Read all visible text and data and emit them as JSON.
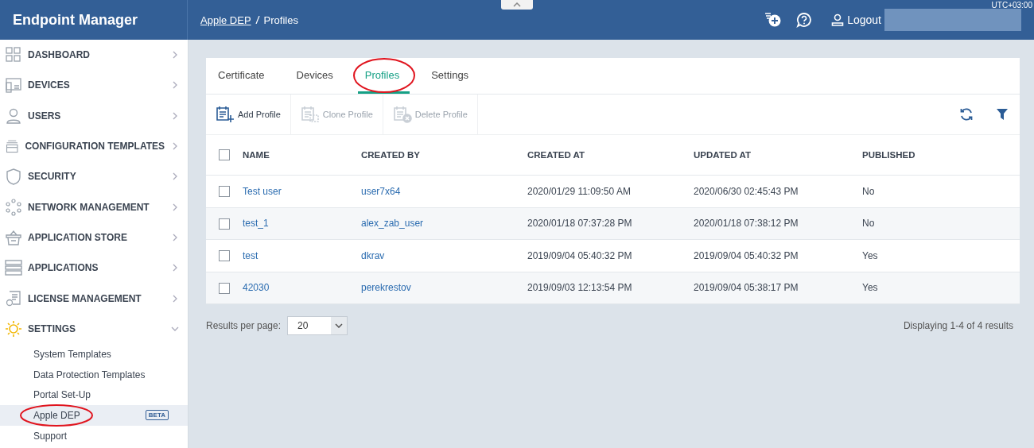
{
  "app": {
    "title": "Endpoint Manager"
  },
  "breadcrumb": [
    {
      "label": "Apple DEP",
      "link": true
    },
    {
      "label": "Profiles",
      "link": false
    }
  ],
  "header": {
    "logout": "Logout",
    "timezone": "UTC+03:00"
  },
  "sidebar": {
    "items": [
      {
        "label": "DASHBOARD",
        "expanded": false
      },
      {
        "label": "DEVICES",
        "expanded": false
      },
      {
        "label": "USERS",
        "expanded": false
      },
      {
        "label": "CONFIGURATION TEMPLATES",
        "expanded": false
      },
      {
        "label": "SECURITY",
        "expanded": false
      },
      {
        "label": "NETWORK MANAGEMENT",
        "expanded": false
      },
      {
        "label": "APPLICATION STORE",
        "expanded": false
      },
      {
        "label": "APPLICATIONS",
        "expanded": false
      },
      {
        "label": "LICENSE MANAGEMENT",
        "expanded": false
      },
      {
        "label": "SETTINGS",
        "expanded": true,
        "children": [
          {
            "label": "System Templates",
            "selected": false,
            "circled": false
          },
          {
            "label": "Data Protection Templates",
            "selected": false,
            "circled": false
          },
          {
            "label": "Portal Set-Up",
            "selected": false,
            "circled": false
          },
          {
            "label": "Apple DEP",
            "selected": true,
            "circled": true,
            "badge": "BETA"
          },
          {
            "label": "Support",
            "selected": false,
            "circled": false
          }
        ]
      }
    ]
  },
  "tabs": [
    {
      "label": "Certificate",
      "selected": false,
      "circled": false
    },
    {
      "label": "Devices",
      "selected": false,
      "circled": false
    },
    {
      "label": "Profiles",
      "selected": true,
      "circled": true
    },
    {
      "label": "Settings",
      "selected": false,
      "circled": false
    }
  ],
  "toolbar": [
    {
      "label": "Add Profile",
      "disabled": false
    },
    {
      "label": "Clone Profile",
      "disabled": true
    },
    {
      "label": "Delete Profile",
      "disabled": true
    }
  ],
  "table": {
    "select_all_checked": false,
    "columns": [
      "NAME",
      "CREATED BY",
      "CREATED AT",
      "UPDATED AT",
      "PUBLISHED"
    ],
    "rows": [
      {
        "checked": false,
        "cells": [
          "Test user",
          "user7x64",
          "2020/01/29 11:09:50 AM",
          "2020/06/30 02:45:43 PM",
          "No"
        ]
      },
      {
        "checked": false,
        "cells": [
          "test_1",
          "alex_zab_user",
          "2020/01/18 07:37:28 PM",
          "2020/01/18 07:38:12 PM",
          "No"
        ]
      },
      {
        "checked": false,
        "cells": [
          "test",
          "dkrav",
          "2019/09/04 05:40:32 PM",
          "2019/09/04 05:40:32 PM",
          "Yes"
        ]
      },
      {
        "checked": false,
        "cells": [
          "42030",
          "perekrestov",
          "2019/09/03 12:13:54 PM",
          "2019/09/04 05:38:17 PM",
          "Yes"
        ]
      }
    ]
  },
  "pagination": {
    "label": "Results per page:",
    "value": "20",
    "summary": "Displaying 1-4 of 4 results"
  }
}
